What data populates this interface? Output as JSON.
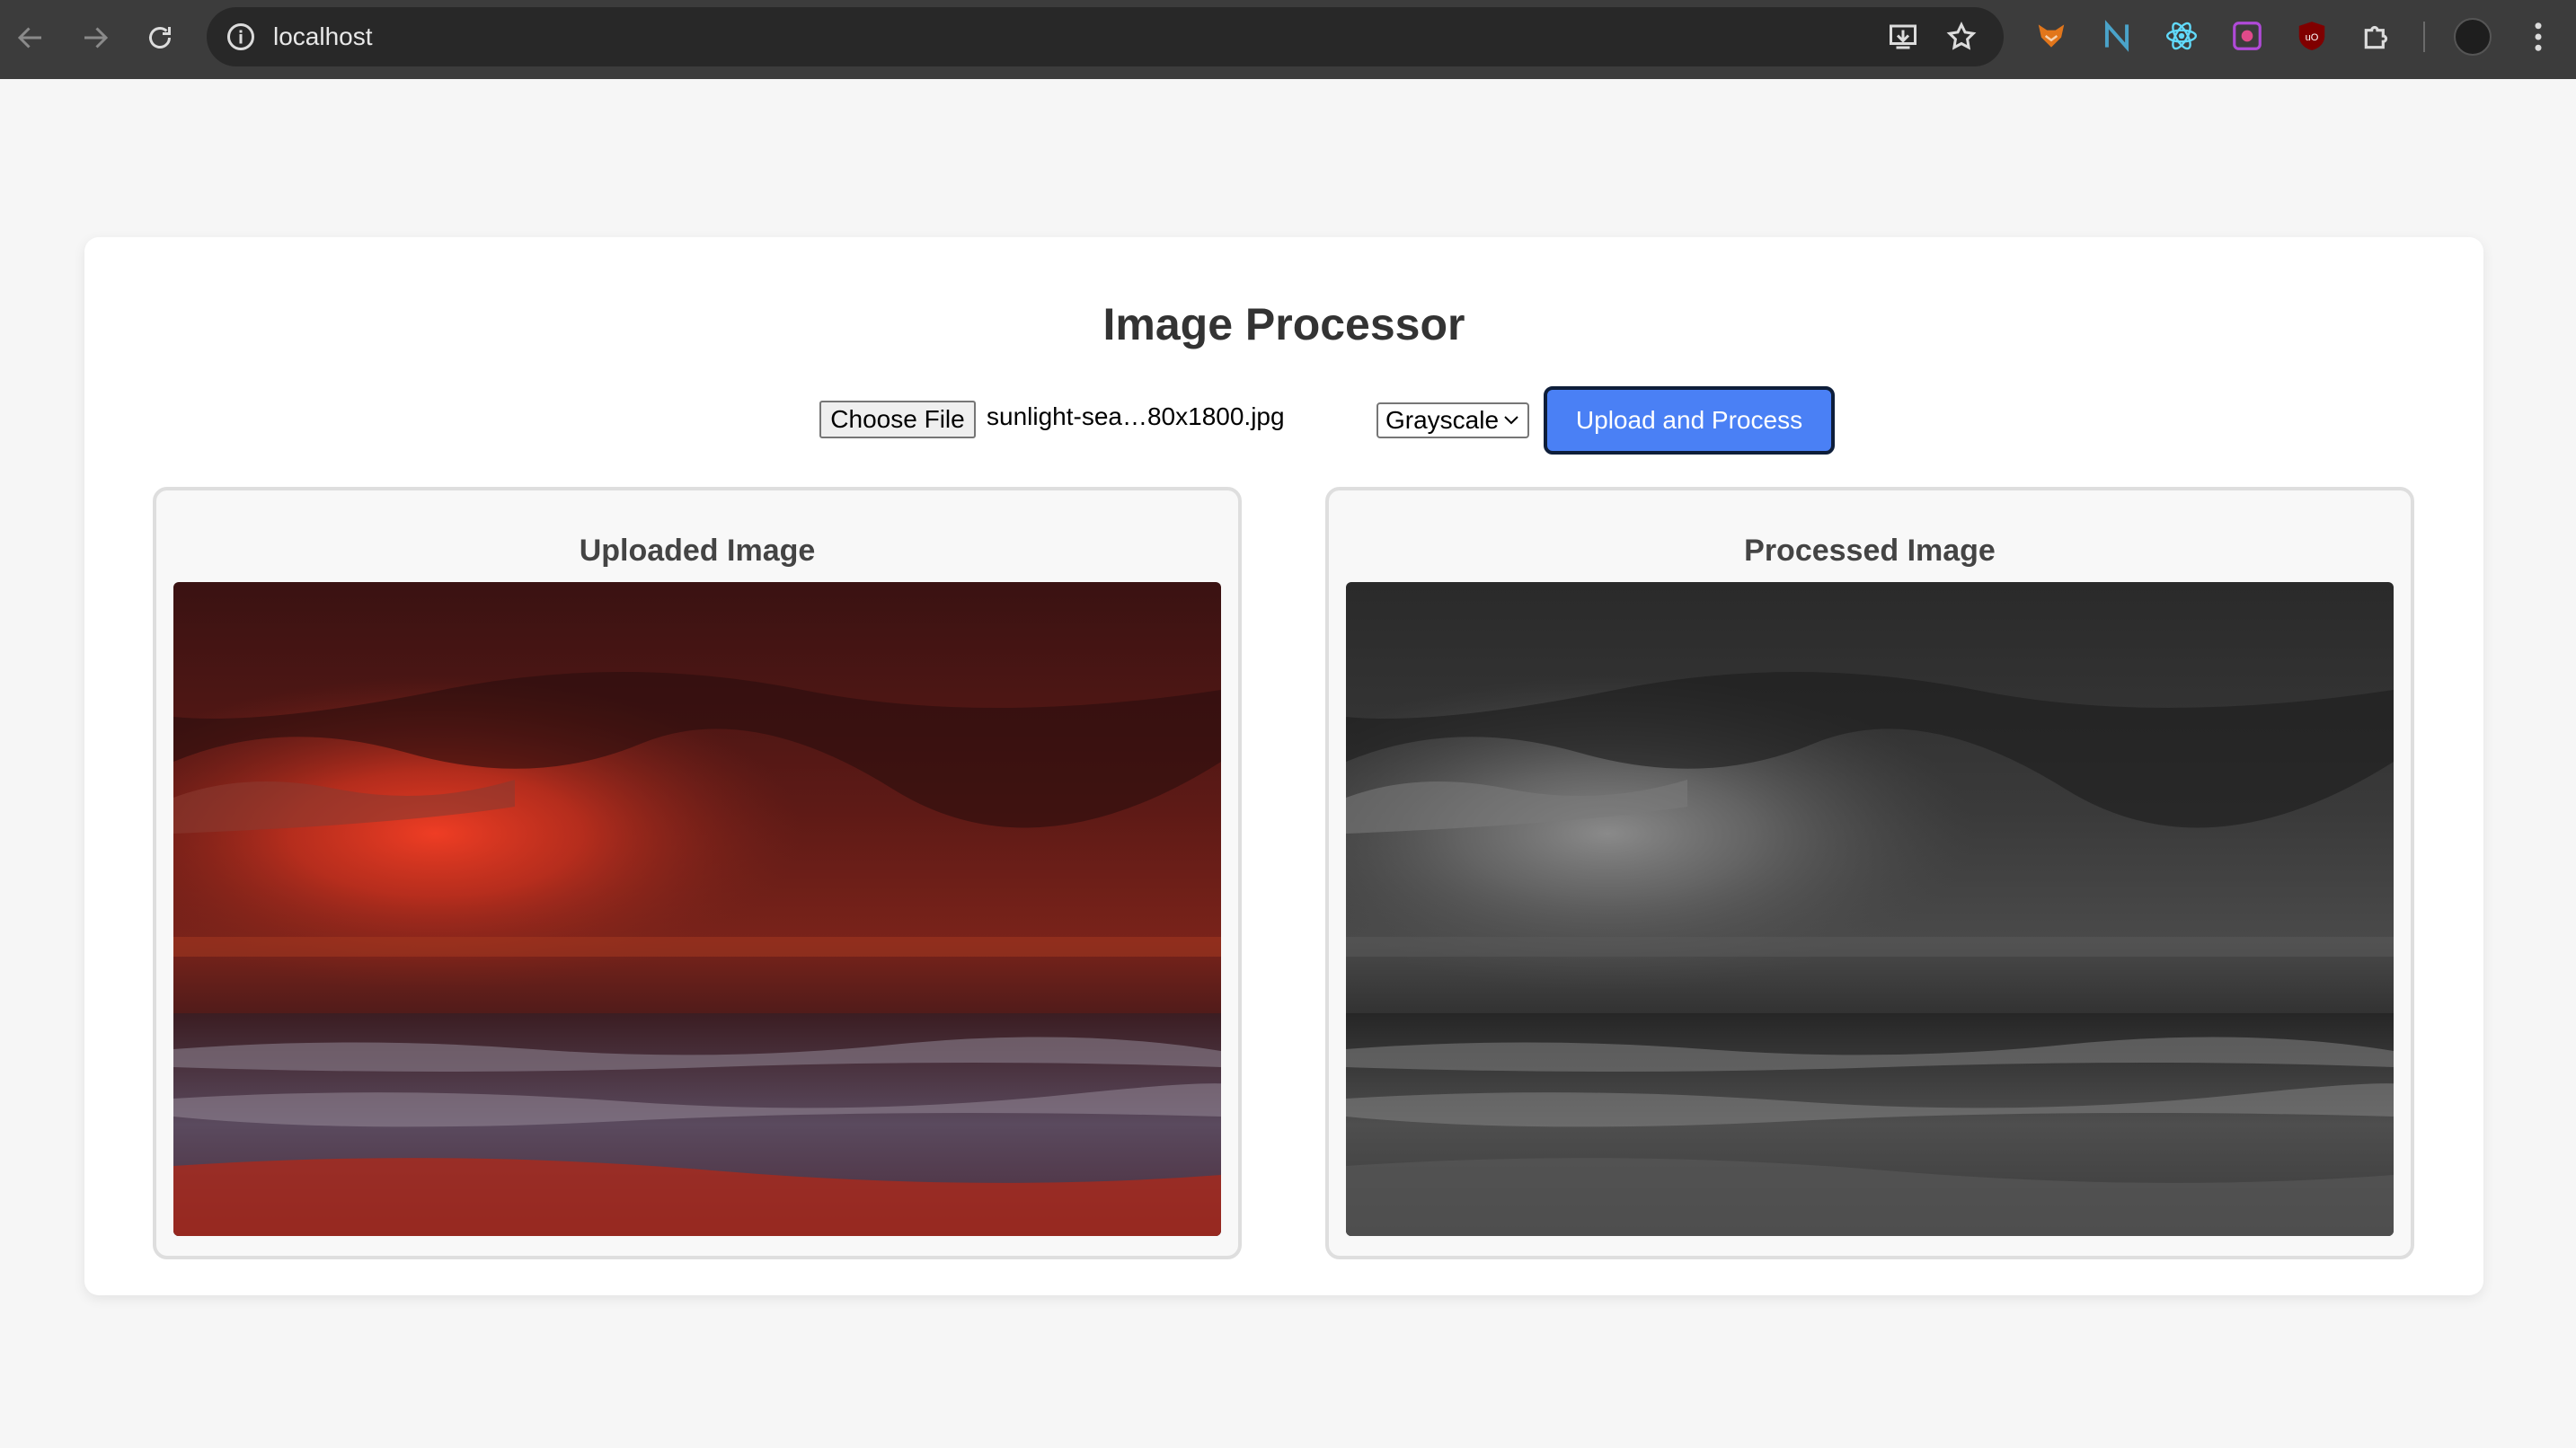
{
  "browser": {
    "url": "localhost",
    "extensions": [
      "fox-extension-icon",
      "n-extension-icon",
      "react-devtools-icon",
      "color-picker-icon",
      "ublock-icon",
      "puzzle-extensions-icon"
    ]
  },
  "page": {
    "title": "Image Processor",
    "choose_file_label": "Choose File",
    "file_name": "sunlight-sea…80x1800.jpg",
    "mode_selected": "Grayscale",
    "upload_button_label": "Upload and Process",
    "uploaded_panel_title": "Uploaded Image",
    "processed_panel_title": "Processed Image"
  },
  "colors": {
    "page_bg": "#f6f6f6",
    "button_accent": "#4a80f5",
    "chrome_bg": "#3c3c3c"
  }
}
